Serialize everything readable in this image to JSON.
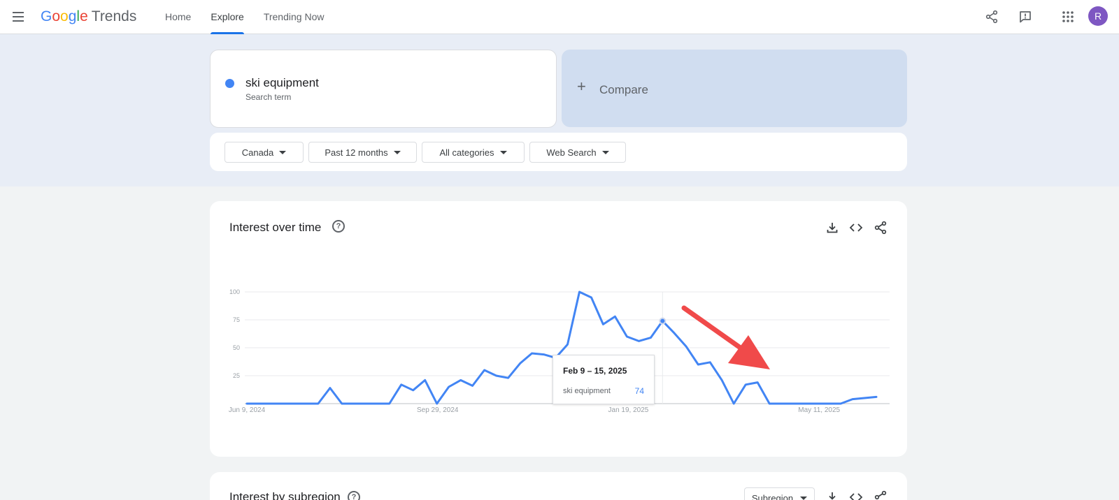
{
  "app": {
    "logo_g": "G",
    "logo_o1": "o",
    "logo_o2": "o",
    "logo_g2": "g",
    "logo_l": "l",
    "logo_e": "e",
    "logo_trends": "Trends",
    "nav": [
      {
        "label": "Home"
      },
      {
        "label": "Explore"
      },
      {
        "label": "Trending Now"
      }
    ],
    "active_nav": "Explore",
    "avatar_letter": "R",
    "icons": [
      "menu-icon",
      "share-icon",
      "feedback-icon",
      "apps-icon"
    ]
  },
  "search": {
    "term": "ski equipment",
    "term_sub": "Search term",
    "term_color": "#4285f4",
    "compare_label": "Compare"
  },
  "filters": [
    {
      "label": "Canada"
    },
    {
      "label": "Past 12 months"
    },
    {
      "label": "All categories"
    },
    {
      "label": "Web Search"
    }
  ],
  "interest_over_time": {
    "title": "Interest over time",
    "tooltip": {
      "date": "Feb 9 – 15, 2025",
      "term": "ski equipment",
      "value": "74"
    }
  },
  "chart_data": {
    "type": "line",
    "x_ticks": [
      "Jun 9, 2024",
      "Sep 29, 2024",
      "Jan 19, 2025",
      "May 11, 2025"
    ],
    "y_ticks": [
      "25",
      "50",
      "75",
      "100"
    ],
    "ylim": [
      0,
      100
    ],
    "grid": true,
    "series": [
      {
        "name": "ski equipment",
        "color": "#4285f4",
        "values": [
          0,
          0,
          0,
          0,
          0,
          0,
          0,
          14,
          0,
          0,
          0,
          0,
          0,
          17,
          12,
          21,
          0,
          15,
          21,
          16,
          30,
          25,
          23,
          36,
          45,
          44,
          41,
          53,
          100,
          95,
          71,
          78,
          60,
          56,
          59,
          74,
          63,
          51,
          35,
          37,
          21,
          0,
          17,
          19,
          0,
          0,
          0,
          0,
          0,
          0,
          0,
          4,
          5,
          6
        ]
      }
    ],
    "highlight_index": 35
  },
  "subregion": {
    "title": "Interest by subregion",
    "select_label": "Subregion"
  }
}
